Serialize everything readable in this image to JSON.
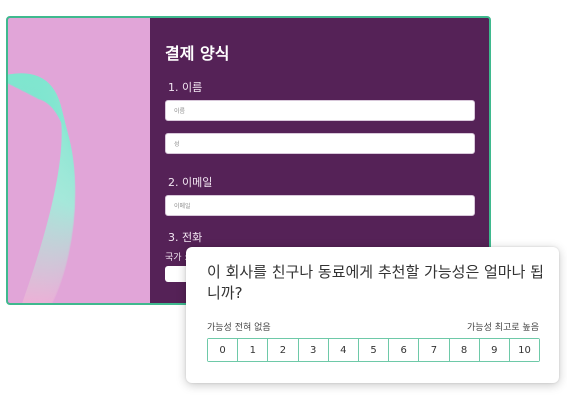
{
  "form": {
    "title": "결제 양식",
    "q1_label": "1. 이름",
    "first_name_placeholder": "이름",
    "last_name_placeholder": "성",
    "q2_label": "2. 이메일",
    "email_placeholder": "이메일",
    "q3_label": "3. 전화",
    "country_label": "국가 :"
  },
  "survey": {
    "question": "이 회사를 친구나 동료에게 추천할 가능성은 얼마나 됩니까?",
    "low_label": "가능성 전혀 없음",
    "high_label": "가능성 최고로 높음",
    "scale": [
      "0",
      "1",
      "2",
      "3",
      "4",
      "5",
      "6",
      "7",
      "8",
      "9",
      "10"
    ]
  },
  "colors": {
    "form_background": "#552257",
    "card_border": "#3fb98e",
    "art_background": "#e1a5d8",
    "scale_border": "#6ec9a8"
  }
}
